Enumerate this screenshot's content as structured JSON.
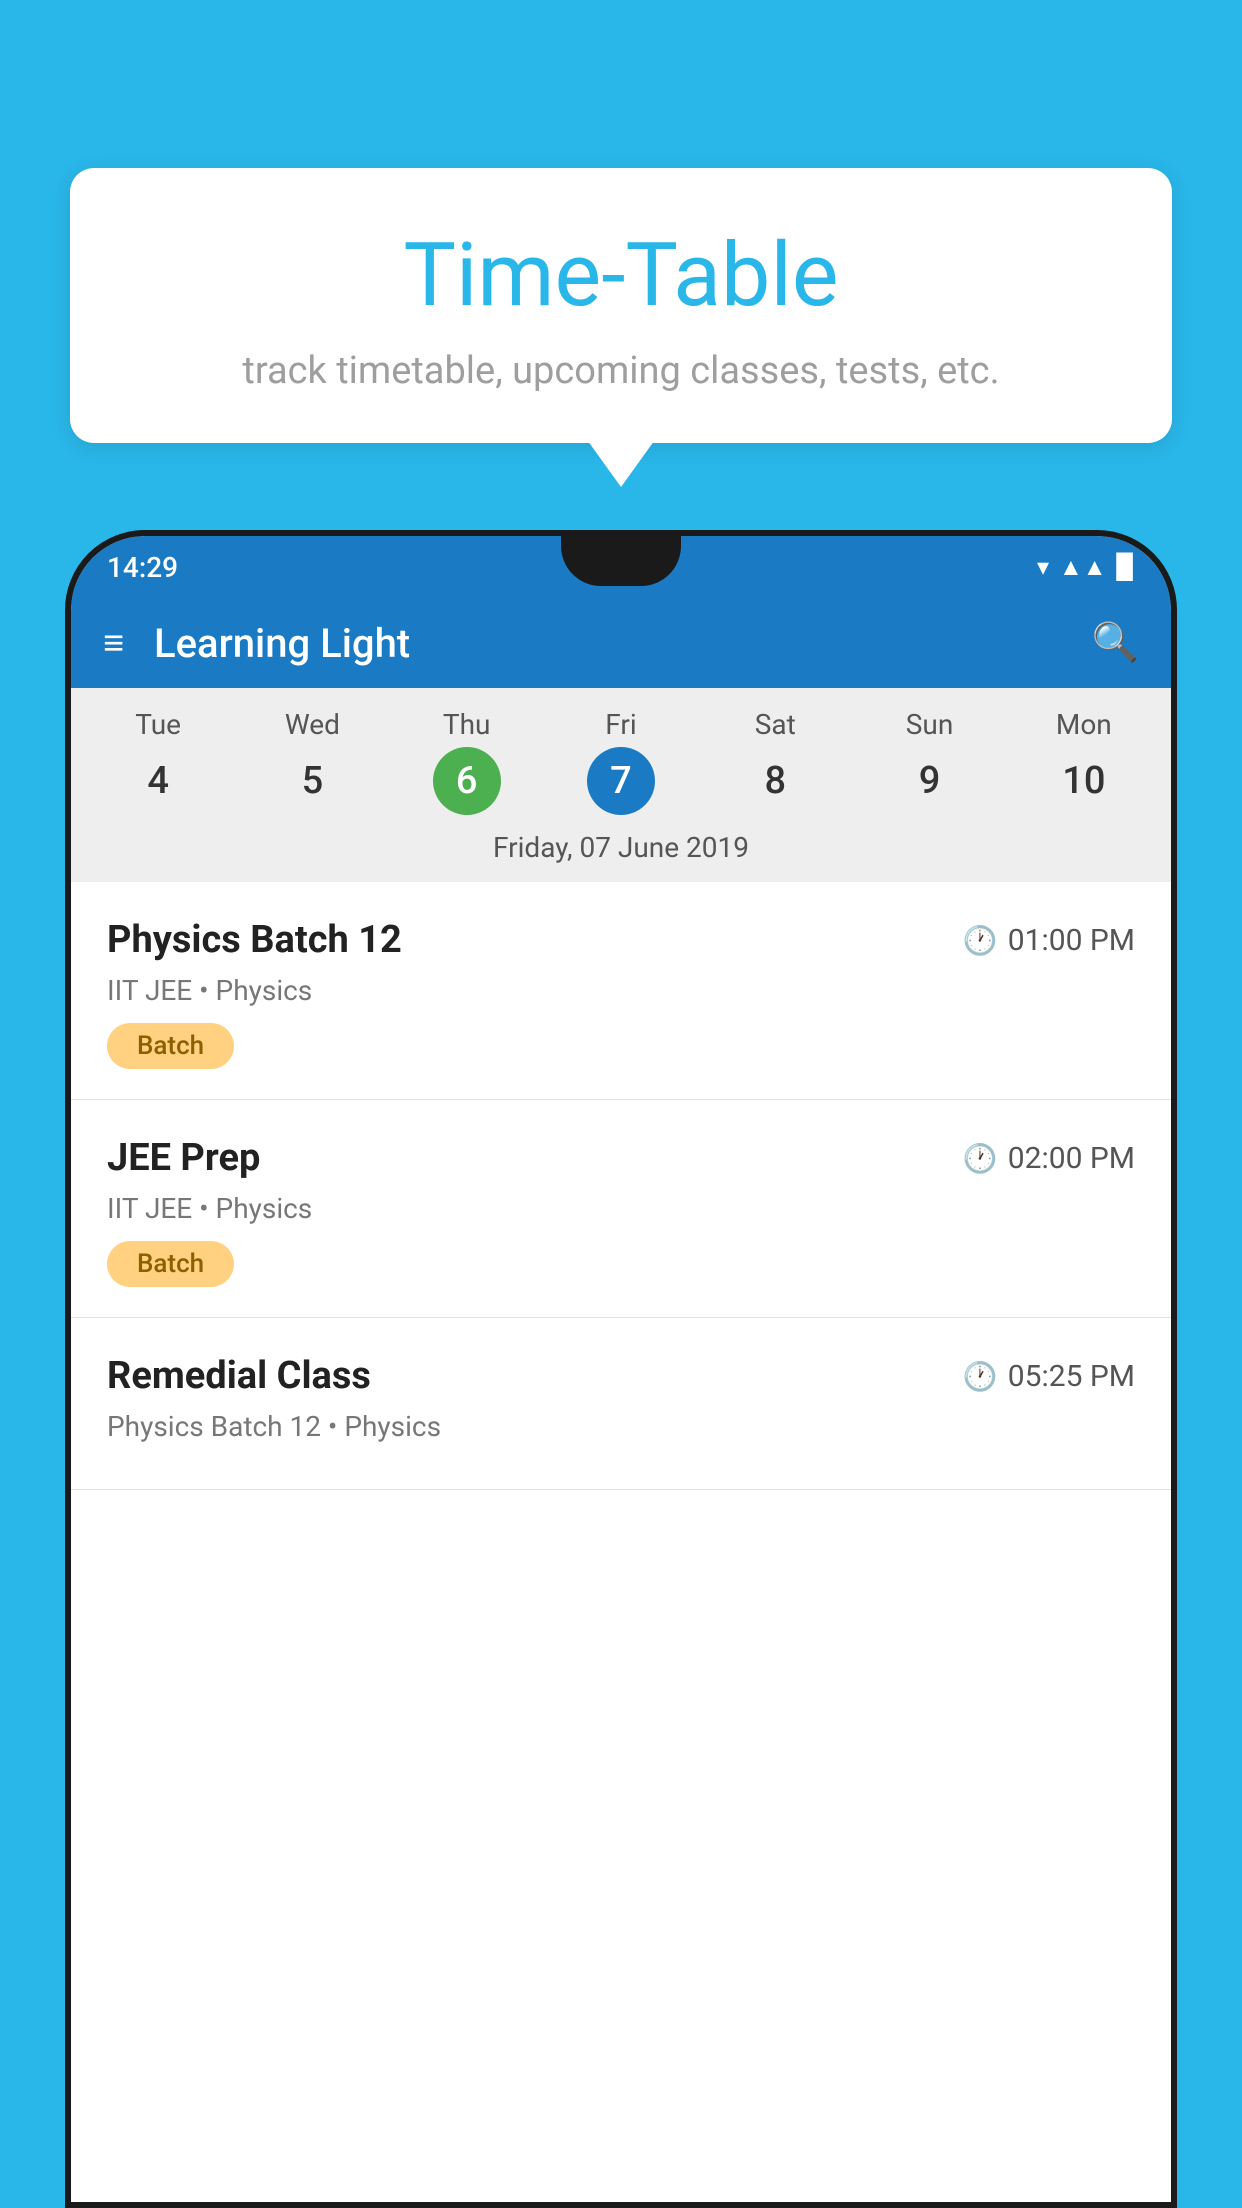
{
  "background_color": "#29B6E8",
  "bubble": {
    "title": "Time-Table",
    "subtitle": "track timetable, upcoming classes, tests, etc."
  },
  "status_bar": {
    "time": "14:29"
  },
  "app_bar": {
    "title": "Learning Light"
  },
  "calendar": {
    "days": [
      {
        "label": "Tue",
        "number": "4"
      },
      {
        "label": "Wed",
        "number": "5"
      },
      {
        "label": "Thu",
        "number": "6",
        "state": "today"
      },
      {
        "label": "Fri",
        "number": "7",
        "state": "selected"
      },
      {
        "label": "Sat",
        "number": "8"
      },
      {
        "label": "Sun",
        "number": "9"
      },
      {
        "label": "Mon",
        "number": "10"
      }
    ],
    "selected_date_label": "Friday, 07 June 2019"
  },
  "events": [
    {
      "name": "Physics Batch 12",
      "time": "01:00 PM",
      "meta": "IIT JEE • Physics",
      "tag": "Batch"
    },
    {
      "name": "JEE Prep",
      "time": "02:00 PM",
      "meta": "IIT JEE • Physics",
      "tag": "Batch"
    },
    {
      "name": "Remedial Class",
      "time": "05:25 PM",
      "meta": "Physics Batch 12 • Physics",
      "tag": ""
    }
  ]
}
